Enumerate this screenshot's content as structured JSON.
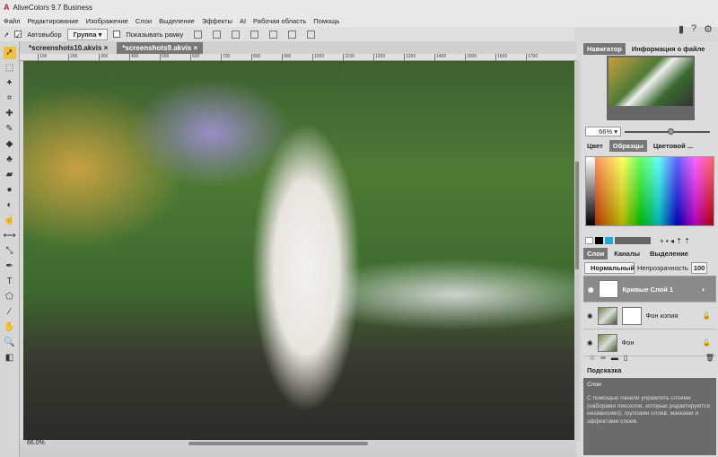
{
  "app": {
    "title": "AliveColors 9.7 Business"
  },
  "menu": [
    "Файл",
    "Редактирование",
    "Изображение",
    "Слои",
    "Выделение",
    "Эффекты",
    "AI",
    "Рабочая область",
    "Помощь"
  ],
  "options": {
    "autoselect_label": "Автовыбор",
    "autoselect_checked": true,
    "group_value": "Группа",
    "show_frame_label": "Показывать рамку",
    "show_frame_checked": false
  },
  "tabs": [
    {
      "label": "*screenshots10.akvis",
      "active": false
    },
    {
      "label": "*screenshots9.akvis",
      "active": true
    }
  ],
  "ruler": [
    "100",
    "200",
    "300",
    "400",
    "500",
    "600",
    "700",
    "800",
    "900",
    "1000",
    "1100",
    "1200",
    "1300",
    "1400",
    "1500",
    "1600",
    "1700",
    "1800"
  ],
  "status": {
    "zoom": "66.0%"
  },
  "navigator": {
    "tabs": [
      "Навигатор",
      "Информация о файле"
    ],
    "zoom": "66%",
    "zoom_slider_percent": 51
  },
  "color_panel": {
    "tabs": [
      "Цвет",
      "Образцы",
      "Цветовой ..."
    ]
  },
  "layers_panel": {
    "tabs": [
      "Слои",
      "Каналы",
      "Выделение"
    ],
    "blend_mode": "Нормальный",
    "opacity_label": "Непрозрачность",
    "opacity_value": "100",
    "layers": [
      {
        "name": "Кривые Слой 1",
        "selected": true
      },
      {
        "name": "Фон копия",
        "selected": false
      },
      {
        "name": "Фон",
        "selected": false
      }
    ]
  },
  "hint": {
    "header": "Подсказка",
    "title": "Слои",
    "text": "С помощью панели управлять слоями (наборами пикселов, которые редактируются независимо), группами слоев, масками и эффектами слоев."
  }
}
